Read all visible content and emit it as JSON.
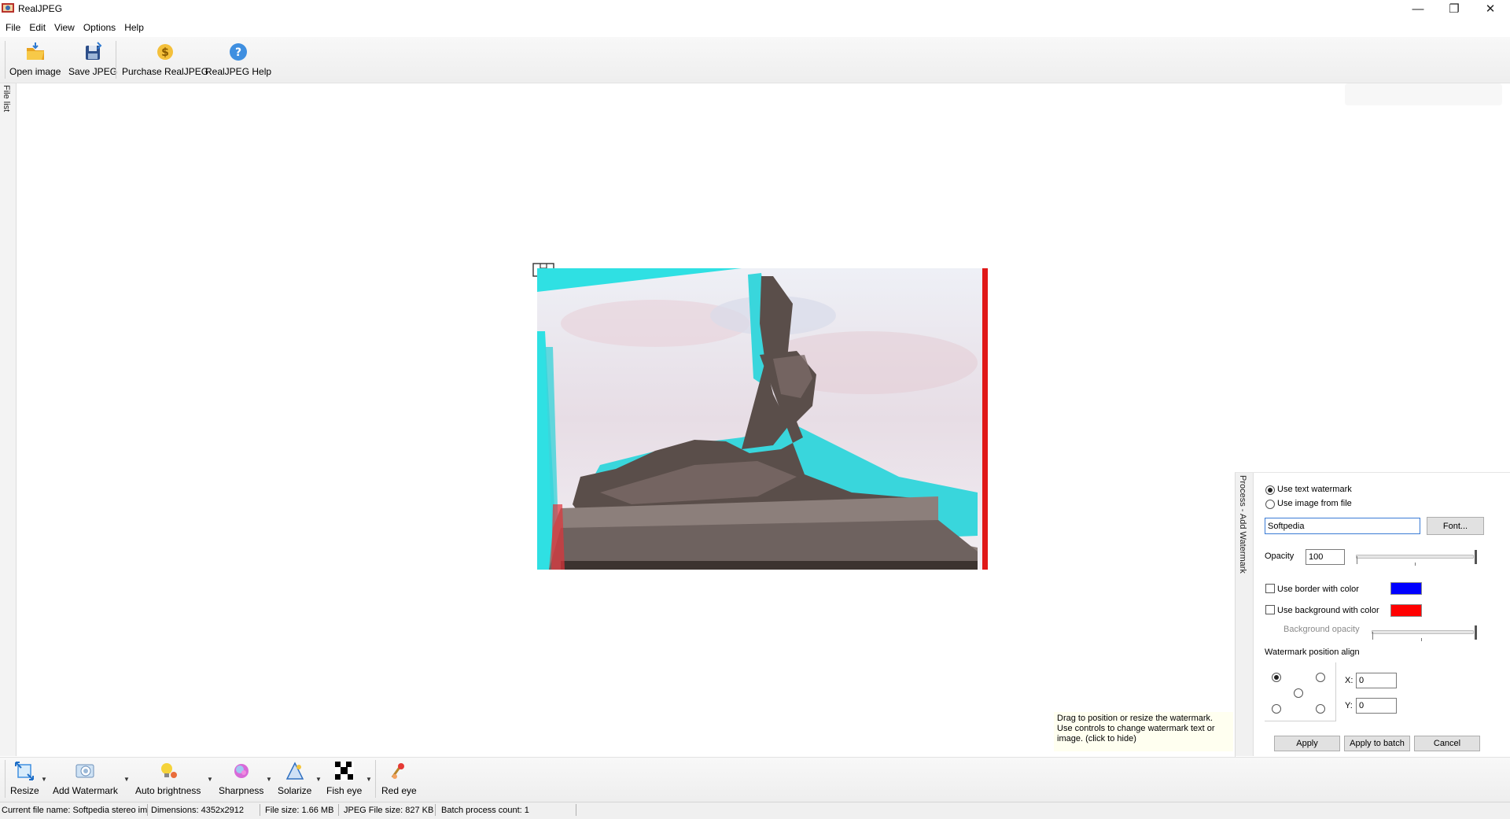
{
  "window": {
    "title": "RealJPEG",
    "minimize": "—",
    "restore": "❐",
    "close": "✕"
  },
  "menu": [
    "File",
    "Edit",
    "View",
    "Options",
    "Help"
  ],
  "toolbar": {
    "open_image": "Open image",
    "save_jpeg": "Save JPEG",
    "purchase": "Purchase RealJPEG",
    "help": "RealJPEG Help"
  },
  "sidebar": {
    "file_list": "File list"
  },
  "watermark_panel": {
    "strip_label": "Process - Add Watermark",
    "use_text": "Use text watermark",
    "use_image": "Use image from file",
    "text_value": "Softpedia",
    "font_button": "Font...",
    "opacity_label": "Opacity",
    "opacity_value": "100",
    "border_label": "Use border with color",
    "background_label": "Use background with color",
    "bg_opacity_label": "Background opacity",
    "position_label": "Watermark position align",
    "x_label": "X:",
    "x_value": "0",
    "y_label": "Y:",
    "y_value": "0",
    "apply": "Apply",
    "apply_batch": "Apply to batch",
    "cancel": "Cancel",
    "colors": {
      "border": "#0000ff",
      "background": "#ff0000"
    },
    "selected_text_mode": true,
    "selected_align": "top-left"
  },
  "hint": "Drag to position or resize the watermark. Use controls to change watermark text or image. (click to hide)",
  "bottom_tools": {
    "resize": "Resize",
    "add_watermark": "Add Watermark",
    "auto_brightness": "Auto brightness",
    "sharpness": "Sharpness",
    "solarize": "Solarize",
    "fish_eye": "Fish eye",
    "red_eye": "Red eye"
  },
  "status": {
    "file_name": "Current file name: Softpedia stereo im",
    "dimensions": "Dimensions: 4352x2912",
    "file_size": "File size: 1.66 MB",
    "jpeg_size": "JPEG File size: 827 KB",
    "batch": "Batch process count: 1"
  }
}
